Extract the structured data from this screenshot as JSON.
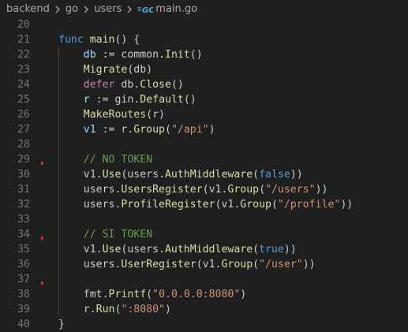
{
  "breadcrumb": {
    "items": [
      "backend",
      "go",
      "users"
    ],
    "file": "main.go"
  },
  "editor": {
    "lines": [
      {
        "number": "20",
        "tokens": []
      },
      {
        "number": "21",
        "tokens": [
          [
            "kw",
            "func"
          ],
          [
            "plain",
            " "
          ],
          [
            "fn",
            "main"
          ],
          [
            "plain",
            "() {"
          ]
        ]
      },
      {
        "number": "22",
        "tokens": [
          [
            "plain",
            "    "
          ],
          [
            "var",
            "db"
          ],
          [
            "plain",
            " := "
          ],
          [
            "plain",
            "common."
          ],
          [
            "fn",
            "Init"
          ],
          [
            "plain",
            "()"
          ]
        ]
      },
      {
        "number": "23",
        "tokens": [
          [
            "plain",
            "    "
          ],
          [
            "fn",
            "Migrate"
          ],
          [
            "plain",
            "(db)"
          ]
        ]
      },
      {
        "number": "24",
        "tokens": [
          [
            "plain",
            "    "
          ],
          [
            "ctl",
            "defer"
          ],
          [
            "plain",
            " db."
          ],
          [
            "fn",
            "Close"
          ],
          [
            "plain",
            "()"
          ]
        ]
      },
      {
        "number": "25",
        "tokens": [
          [
            "plain",
            "    "
          ],
          [
            "var",
            "r"
          ],
          [
            "plain",
            " := gin."
          ],
          [
            "fn",
            "Default"
          ],
          [
            "plain",
            "()"
          ]
        ]
      },
      {
        "number": "26",
        "tokens": [
          [
            "plain",
            "    "
          ],
          [
            "fn",
            "MakeRoutes"
          ],
          [
            "plain",
            "(r)"
          ]
        ]
      },
      {
        "number": "27",
        "tokens": [
          [
            "plain",
            "    "
          ],
          [
            "var",
            "v1"
          ],
          [
            "plain",
            " := r."
          ],
          [
            "fn",
            "Group"
          ],
          [
            "plain",
            "("
          ],
          [
            "str",
            "\"/api\""
          ],
          [
            "plain",
            ")"
          ]
        ]
      },
      {
        "number": "28",
        "tokens": []
      },
      {
        "number": "29",
        "tokens": [
          [
            "plain",
            "    "
          ],
          [
            "cm",
            "// NO TOKEN"
          ]
        ]
      },
      {
        "number": "30",
        "tokens": [
          [
            "plain",
            "    v1."
          ],
          [
            "fn",
            "Use"
          ],
          [
            "plain",
            "(users."
          ],
          [
            "fn",
            "AuthMiddleware"
          ],
          [
            "plain",
            "("
          ],
          [
            "kw",
            "false"
          ],
          [
            "plain",
            "))"
          ]
        ]
      },
      {
        "number": "31",
        "tokens": [
          [
            "plain",
            "    users."
          ],
          [
            "fn",
            "UsersRegister"
          ],
          [
            "plain",
            "(v1."
          ],
          [
            "fn",
            "Group"
          ],
          [
            "plain",
            "("
          ],
          [
            "str",
            "\"/users\""
          ],
          [
            "plain",
            "))"
          ]
        ]
      },
      {
        "number": "32",
        "tokens": [
          [
            "plain",
            "    users."
          ],
          [
            "fn",
            "ProfileRegister"
          ],
          [
            "plain",
            "(v1."
          ],
          [
            "fn",
            "Group"
          ],
          [
            "plain",
            "("
          ],
          [
            "str",
            "\"/profile\""
          ],
          [
            "plain",
            "))"
          ]
        ]
      },
      {
        "number": "33",
        "tokens": []
      },
      {
        "number": "34",
        "tokens": [
          [
            "plain",
            "    "
          ],
          [
            "cm",
            "// SI TOKEN"
          ]
        ]
      },
      {
        "number": "35",
        "tokens": [
          [
            "plain",
            "    v1."
          ],
          [
            "fn",
            "Use"
          ],
          [
            "plain",
            "(users."
          ],
          [
            "fn",
            "AuthMiddleware"
          ],
          [
            "plain",
            "("
          ],
          [
            "kw",
            "true"
          ],
          [
            "plain",
            "))"
          ]
        ]
      },
      {
        "number": "36",
        "tokens": [
          [
            "plain",
            "    users."
          ],
          [
            "fn",
            "UserRegister"
          ],
          [
            "plain",
            "(v1."
          ],
          [
            "fn",
            "Group"
          ],
          [
            "plain",
            "("
          ],
          [
            "str",
            "\"/user\""
          ],
          [
            "plain",
            "))"
          ]
        ]
      },
      {
        "number": "37",
        "tokens": []
      },
      {
        "number": "38",
        "tokens": [
          [
            "plain",
            "    fmt."
          ],
          [
            "fn",
            "Printf"
          ],
          [
            "plain",
            "("
          ],
          [
            "str",
            "\"0.0.0.0:8080\""
          ],
          [
            "plain",
            ")"
          ]
        ]
      },
      {
        "number": "39",
        "tokens": [
          [
            "plain",
            "    r."
          ],
          [
            "fn",
            "Run"
          ],
          [
            "plain",
            "("
          ],
          [
            "str",
            "\":8080\""
          ],
          [
            "plain",
            ")"
          ]
        ]
      },
      {
        "number": "40",
        "tokens": [
          [
            "plain",
            "}"
          ]
        ]
      }
    ]
  },
  "gutter_markers": [
    "29",
    "34",
    "37"
  ],
  "colors": {
    "background": "#1f1f1f",
    "keyword": "#569cd6",
    "function": "#dcdcaa",
    "variable": "#9cdcfe",
    "string": "#ce9178",
    "comment": "#6a9955",
    "control": "#c586c0",
    "line_number": "#6e7681",
    "marker": "#c0392b"
  }
}
